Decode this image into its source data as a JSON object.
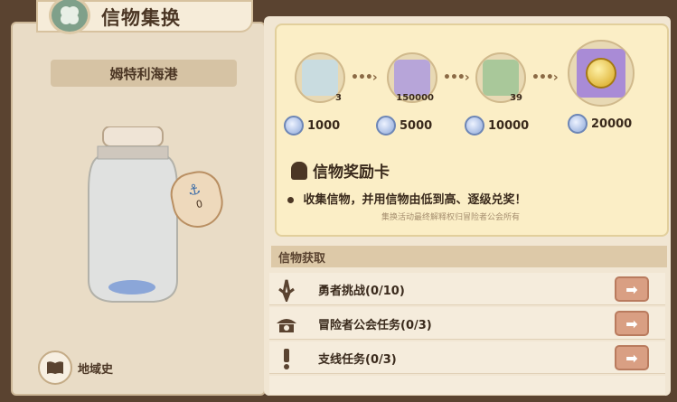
{
  "header": {
    "title": "信物集换"
  },
  "location": {
    "name": "姆特利海港"
  },
  "jar": {
    "tag_count": "0"
  },
  "history": {
    "label": "地域史"
  },
  "rewards": {
    "items": [
      {
        "count": "3",
        "cost": "1000",
        "icon": "chest-icon"
      },
      {
        "count": "150000",
        "cost": "5000",
        "icon": "clover-icon"
      },
      {
        "count": "39",
        "cost": "10000",
        "icon": "scroll-icon"
      },
      {
        "count": "",
        "cost": "20000",
        "icon": "gold-coin-icon"
      }
    ],
    "arrow": "•••›"
  },
  "card": {
    "title": "信物奖励卡",
    "desc": "收集信物，并用信物由低到高、逐级兑奖！",
    "note": "集换活动最终解释权归冒险者公会所有"
  },
  "acquire": {
    "header": "信物获取",
    "rows": [
      {
        "label": "勇者挑战(0/10)",
        "icon": "sword-icon"
      },
      {
        "label": "冒险者公会任务(0/3)",
        "icon": "guild-icon"
      },
      {
        "label": "支线任务(0/3)",
        "icon": "exclamation-icon"
      }
    ],
    "go_arrow": "➡"
  },
  "colors": {
    "panel": "#f1e6d3",
    "accent": "#d99f83",
    "coin": "#8ba6d8"
  }
}
